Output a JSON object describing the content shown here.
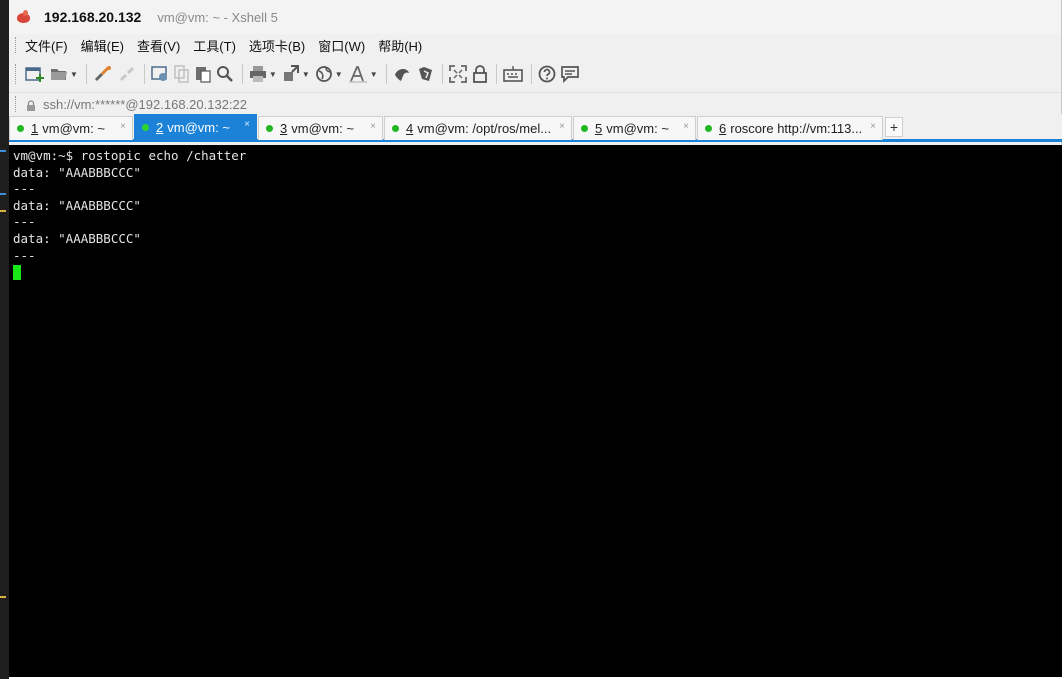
{
  "window": {
    "host": "192.168.20.132",
    "subtitle": "vm@vm: ~ - Xshell 5"
  },
  "menu": [
    {
      "label": "文件(F)"
    },
    {
      "label": "编辑(E)"
    },
    {
      "label": "查看(V)"
    },
    {
      "label": "工具(T)"
    },
    {
      "label": "选项卡(B)"
    },
    {
      "label": "窗口(W)"
    },
    {
      "label": "帮助(H)"
    }
  ],
  "toolbar": {
    "icons": [
      "new-session-icon",
      "open-folder-icon",
      "connect-icon",
      "disconnect-icon",
      "properties-icon",
      "copy-icon",
      "paste-icon",
      "find-icon",
      "print-icon",
      "transfer-icon",
      "globe-icon",
      "font-icon",
      "xftp-icon",
      "new-window-icon",
      "fullscreen-icon",
      "lock-icon",
      "keyboard-icon",
      "help-icon",
      "chat-icon"
    ]
  },
  "address": {
    "text": "ssh://vm:******@192.168.20.132:22"
  },
  "tabs": [
    {
      "num": "1",
      "label": "vm@vm: ~",
      "status": "connected",
      "active": false
    },
    {
      "num": "2",
      "label": "vm@vm: ~",
      "status": "connected",
      "active": true
    },
    {
      "num": "3",
      "label": "vm@vm: ~",
      "status": "connected",
      "active": false
    },
    {
      "num": "4",
      "label": "vm@vm: /opt/ros/mel...",
      "status": "connected",
      "active": false
    },
    {
      "num": "5",
      "label": "vm@vm: ~",
      "status": "connected",
      "active": false
    },
    {
      "num": "6",
      "label": "roscore http://vm:113...",
      "status": "connected",
      "active": false
    }
  ],
  "tab_close_glyph": "×",
  "tab_add_glyph": "+",
  "terminal": {
    "lines": [
      "vm@vm:~$ rostopic echo /chatter",
      "data: \"AAABBBCCC\"",
      "---",
      "data: \"AAABBBCCC\"",
      "---",
      "data: \"AAABBBCCC\"",
      "---"
    ]
  },
  "colors": {
    "active_tab": "#1c82d8",
    "status_dot": "#22b722",
    "terminal_bg": "#000000",
    "terminal_fg": "#e4e4e4",
    "cursor": "#18e818"
  }
}
